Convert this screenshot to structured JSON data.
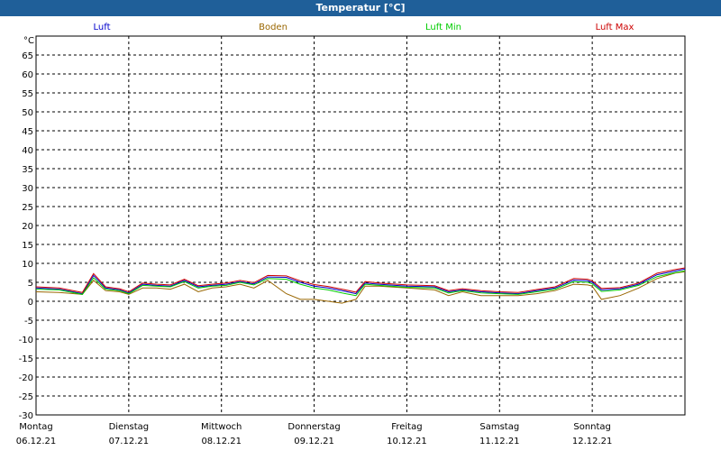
{
  "title": "Temperatur [°C]",
  "chart_data": {
    "type": "line",
    "unit_label": "°C",
    "ylim": [
      -30,
      70
    ],
    "y_ticks": [
      65,
      60,
      55,
      50,
      45,
      40,
      35,
      30,
      25,
      20,
      15,
      10,
      5,
      0,
      -5,
      -10,
      -15,
      -20,
      -25,
      -30
    ],
    "x_ticks": [
      {
        "day": "Montag",
        "date": "06.12.21"
      },
      {
        "day": "Dienstag",
        "date": "07.12.21"
      },
      {
        "day": "Mittwoch",
        "date": "08.12.21"
      },
      {
        "day": "Donnerstag",
        "date": "09.12.21"
      },
      {
        "day": "Freitag",
        "date": "10.12.21"
      },
      {
        "day": "Samstag",
        "date": "11.12.21"
      },
      {
        "day": "Sonntag",
        "date": "12.12.21"
      }
    ],
    "x_range_days": [
      0,
      7
    ],
    "grid": true,
    "legend_position": "top",
    "series": [
      {
        "name": "Luft",
        "color": "#0000cc",
        "x": [
          0,
          0.25,
          0.5,
          0.62,
          0.75,
          0.9,
          1.0,
          1.15,
          1.3,
          1.45,
          1.6,
          1.75,
          1.9,
          2.05,
          2.2,
          2.35,
          2.5,
          2.7,
          2.85,
          3.0,
          3.15,
          3.3,
          3.45,
          3.55,
          3.7,
          4.0,
          4.3,
          4.45,
          4.6,
          4.8,
          5.0,
          5.2,
          5.4,
          5.6,
          5.8,
          5.95,
          6.0,
          6.1,
          6.3,
          6.5,
          6.7,
          6.9,
          7.0
        ],
        "y": [
          3.5,
          3.2,
          2.0,
          6.8,
          3.5,
          3.0,
          2.2,
          4.5,
          4.2,
          4.0,
          5.5,
          3.8,
          4.2,
          4.5,
          5.2,
          4.6,
          6.4,
          6.3,
          5.0,
          4.0,
          3.5,
          2.8,
          2.0,
          4.8,
          4.5,
          4.0,
          3.8,
          2.5,
          3.0,
          2.5,
          2.2,
          2.0,
          2.8,
          3.5,
          5.6,
          5.4,
          5.0,
          3.0,
          3.3,
          4.5,
          7.0,
          8.0,
          8.5
        ]
      },
      {
        "name": "Boden",
        "color": "#996600",
        "x": [
          0,
          0.25,
          0.5,
          0.62,
          0.75,
          0.9,
          1.0,
          1.15,
          1.3,
          1.45,
          1.6,
          1.75,
          1.9,
          2.05,
          2.2,
          2.35,
          2.5,
          2.7,
          2.85,
          3.0,
          3.15,
          3.3,
          3.45,
          3.55,
          3.7,
          4.0,
          4.3,
          4.45,
          4.6,
          4.8,
          5.0,
          5.2,
          5.4,
          5.6,
          5.8,
          5.95,
          6.0,
          6.1,
          6.3,
          6.5,
          6.7,
          6.9,
          7.0
        ],
        "y": [
          2.5,
          2.3,
          1.8,
          5.5,
          2.8,
          2.5,
          1.8,
          3.5,
          3.5,
          3.2,
          4.5,
          2.5,
          3.5,
          3.8,
          4.5,
          3.5,
          5.5,
          2.0,
          0.5,
          0.5,
          0.0,
          -0.5,
          0.5,
          4.0,
          4.0,
          3.5,
          3.0,
          1.5,
          2.5,
          1.5,
          1.5,
          1.5,
          2.0,
          2.8,
          4.5,
          4.3,
          4.0,
          0.5,
          1.5,
          3.5,
          6.0,
          7.5,
          7.8
        ]
      },
      {
        "name": "Luft Min",
        "color": "#00cc00",
        "x": [
          0,
          0.25,
          0.5,
          0.62,
          0.75,
          0.9,
          1.0,
          1.15,
          1.3,
          1.45,
          1.6,
          1.75,
          1.9,
          2.05,
          2.2,
          2.35,
          2.5,
          2.7,
          2.85,
          3.0,
          3.15,
          3.3,
          3.45,
          3.55,
          3.7,
          4.0,
          4.3,
          4.45,
          4.6,
          4.8,
          5.0,
          5.2,
          5.4,
          5.6,
          5.8,
          5.95,
          6.0,
          6.1,
          6.3,
          6.5,
          6.7,
          6.9,
          7.0
        ],
        "y": [
          3.2,
          3.0,
          1.8,
          6.2,
          3.2,
          2.8,
          2.0,
          4.2,
          4.0,
          3.8,
          5.2,
          3.5,
          4.0,
          4.2,
          5.0,
          4.3,
          6.0,
          5.8,
          4.5,
          3.5,
          3.0,
          2.2,
          1.5,
          4.5,
          4.2,
          3.7,
          3.5,
          2.2,
          2.8,
          2.2,
          2.0,
          1.8,
          2.5,
          3.2,
          5.2,
          5.0,
          4.6,
          2.6,
          3.0,
          4.2,
          6.5,
          7.6,
          8.0
        ]
      },
      {
        "name": "Luft Max",
        "color": "#cc0000",
        "x": [
          0,
          0.25,
          0.5,
          0.62,
          0.75,
          0.9,
          1.0,
          1.15,
          1.3,
          1.45,
          1.6,
          1.75,
          1.9,
          2.05,
          2.2,
          2.35,
          2.5,
          2.7,
          2.85,
          3.0,
          3.15,
          3.3,
          3.45,
          3.55,
          3.7,
          4.0,
          4.3,
          4.45,
          4.6,
          4.8,
          5.0,
          5.2,
          5.4,
          5.6,
          5.8,
          5.95,
          6.0,
          6.1,
          6.3,
          6.5,
          6.7,
          6.9,
          7.0
        ],
        "y": [
          3.8,
          3.5,
          2.3,
          7.3,
          3.8,
          3.3,
          2.5,
          4.8,
          4.5,
          4.3,
          5.8,
          4.1,
          4.5,
          4.8,
          5.5,
          4.9,
          6.8,
          6.7,
          5.4,
          4.4,
          3.9,
          3.2,
          2.4,
          5.2,
          4.8,
          4.3,
          4.1,
          2.8,
          3.3,
          2.8,
          2.5,
          2.3,
          3.1,
          3.8,
          6.0,
          5.8,
          5.4,
          3.4,
          3.6,
          4.8,
          7.4,
          8.4,
          8.8
        ]
      }
    ]
  }
}
